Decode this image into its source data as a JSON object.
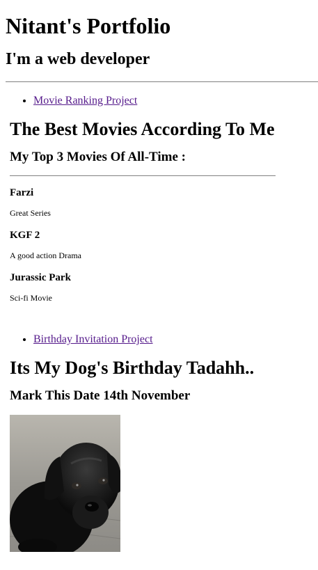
{
  "header": {
    "title": "Nitant's Portfolio",
    "tagline": "I'm a web developer"
  },
  "projects": [
    {
      "link_label": "Movie Ranking Project",
      "heading": "The Best Movies According To Me",
      "subheading": "My Top 3 Movies Of All-Time :",
      "movies": [
        {
          "name": "Farzi",
          "description": "Great Series"
        },
        {
          "name": "KGF 2",
          "description": "A good action Drama"
        },
        {
          "name": "Jurassic Park",
          "description": "Sci-fi Movie"
        }
      ]
    },
    {
      "link_label": "Birthday Invitation Project",
      "heading": "Its My Dog's Birthday Tadahh..",
      "subheading": "Mark This Date 14th November",
      "image_icon": "black-puppy-photo"
    }
  ],
  "colors": {
    "link_visited": "#551a8b",
    "divider": "#808080",
    "background": "#ffffff",
    "text": "#000000"
  }
}
